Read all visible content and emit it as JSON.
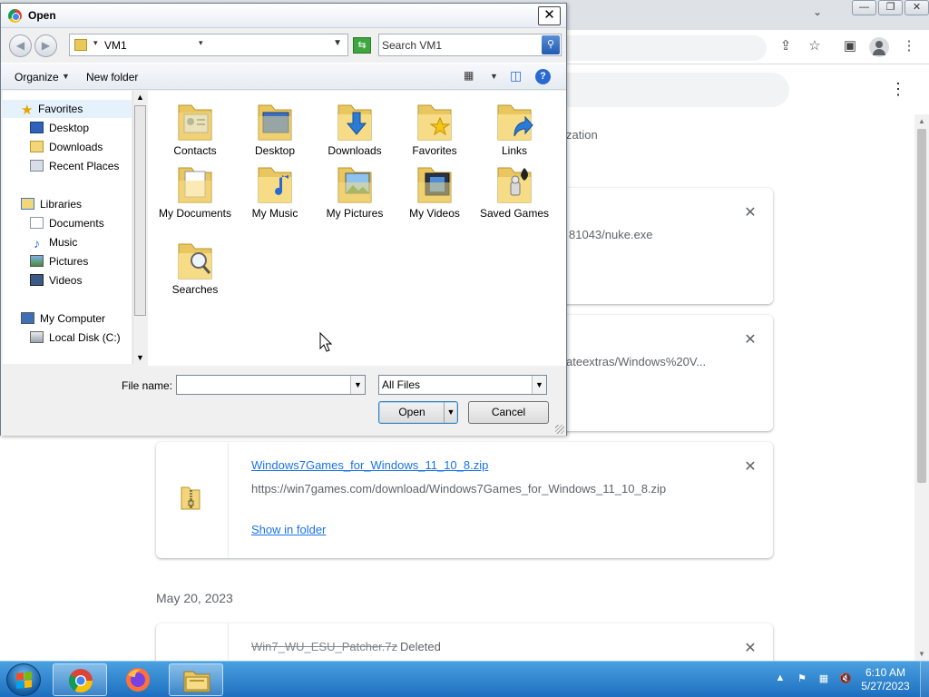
{
  "chrome": {
    "tabs_dropdown_icon": "chevron-down-icon",
    "window_buttons": {
      "minimize": "—",
      "restore": "❐",
      "close": "✕"
    },
    "clipped_texts": [
      "zation",
      "81043/nuke.exe",
      "ateextras/Windows%20V..."
    ],
    "downloads": [
      {
        "filename": "Windows7Games_for_Windows_11_10_8.zip",
        "url": "https://win7games.com/download/Windows7Games_for_Windows_11_10_8.zip",
        "action": "Show in folder",
        "close": "✕"
      }
    ],
    "date_heading": "May 20, 2023",
    "deleted": {
      "filename": "Win7_WU_ESU_Patcher.7z",
      "status": "Deleted",
      "close": "✕"
    },
    "card_close": "✕",
    "menu": "⋮"
  },
  "dialog": {
    "title": "Open",
    "close_glyph": "✕",
    "address": "VM1",
    "search_placeholder": "Search VM1",
    "toolbar": {
      "organize": "Organize",
      "new_folder": "New folder"
    },
    "nav_tree": {
      "favorites": "Favorites",
      "favorites_items": [
        "Desktop",
        "Downloads",
        "Recent Places"
      ],
      "libraries": "Libraries",
      "libraries_items": [
        "Documents",
        "Music",
        "Pictures",
        "Videos"
      ],
      "computer": "My Computer",
      "computer_items": [
        "Local Disk (C:)"
      ]
    },
    "folders": [
      {
        "label": "Contacts",
        "icon": "contacts-folder-icon"
      },
      {
        "label": "Desktop",
        "icon": "desktop-folder-icon"
      },
      {
        "label": "Downloads",
        "icon": "downloads-folder-icon"
      },
      {
        "label": "Favorites",
        "icon": "favorites-folder-icon"
      },
      {
        "label": "Links",
        "icon": "links-folder-icon"
      },
      {
        "label": "My Documents",
        "icon": "documents-folder-icon"
      },
      {
        "label": "My Music",
        "icon": "music-folder-icon"
      },
      {
        "label": "My Pictures",
        "icon": "pictures-folder-icon"
      },
      {
        "label": "My Videos",
        "icon": "videos-folder-icon"
      },
      {
        "label": "Saved Games",
        "icon": "saved-games-folder-icon"
      },
      {
        "label": "Searches",
        "icon": "searches-folder-icon"
      }
    ],
    "file_name_label": "File name:",
    "file_name_value": "",
    "file_type": "All Files",
    "open_button": "Open",
    "cancel_button": "Cancel"
  },
  "taskbar": {
    "clock_time": "6:10 AM",
    "clock_date": "5/27/2023",
    "apps": [
      "chrome-icon",
      "firefox-icon",
      "file-explorer-icon"
    ]
  },
  "colors": {
    "link_blue": "#1a73e8",
    "taskbar_blue": "#1d6fbf",
    "folder_yellow": "#f3d57a",
    "dialog_bg": "#f0f0f0"
  }
}
